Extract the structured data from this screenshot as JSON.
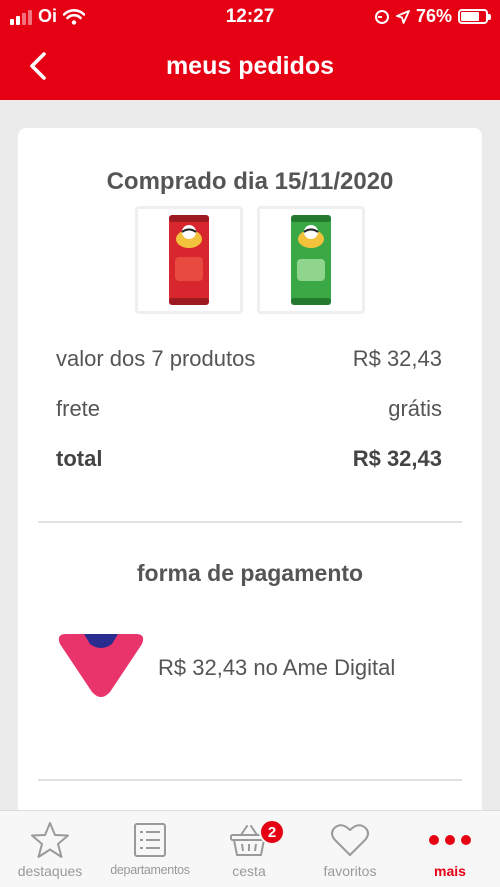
{
  "status_bar": {
    "carrier": "Oi",
    "time": "12:27",
    "battery": "76%",
    "battery_level": 0.76,
    "icons": [
      "signal-icon",
      "wifi-icon",
      "location-lock-icon",
      "location-arrow-icon",
      "battery-icon"
    ]
  },
  "header": {
    "title": "meus pedidos",
    "back_icon": "chevron-left-icon"
  },
  "order": {
    "date_label": "Comprado dia 15/11/2020",
    "products": [
      {
        "name": "Pringles",
        "color": "#d8262e"
      },
      {
        "name": "Pringles",
        "color": "#3aa845"
      }
    ],
    "summary": {
      "items_label": "valor dos 7 produtos",
      "items_value": "R$ 32,43",
      "shipping_label": "frete",
      "shipping_value": "grátis",
      "total_label": "total",
      "total_value": "R$ 32,43"
    }
  },
  "payment": {
    "title": "forma de pagamento",
    "description": "R$ 32,43 no Ame Digital",
    "logo_colors": [
      "#e8336b",
      "#2b2c8f"
    ]
  },
  "tabbar": {
    "items": [
      {
        "label": "destaques",
        "icon": "star-icon"
      },
      {
        "label": "departamentos",
        "icon": "list-icon"
      },
      {
        "label": "cesta",
        "icon": "basket-icon",
        "badge": "2"
      },
      {
        "label": "favoritos",
        "icon": "heart-icon"
      },
      {
        "label": "mais",
        "icon": "more-dots-icon"
      }
    ]
  },
  "colors": {
    "brand_red": "#e60014",
    "text_gray": "#555555",
    "background": "#ebebeb"
  }
}
